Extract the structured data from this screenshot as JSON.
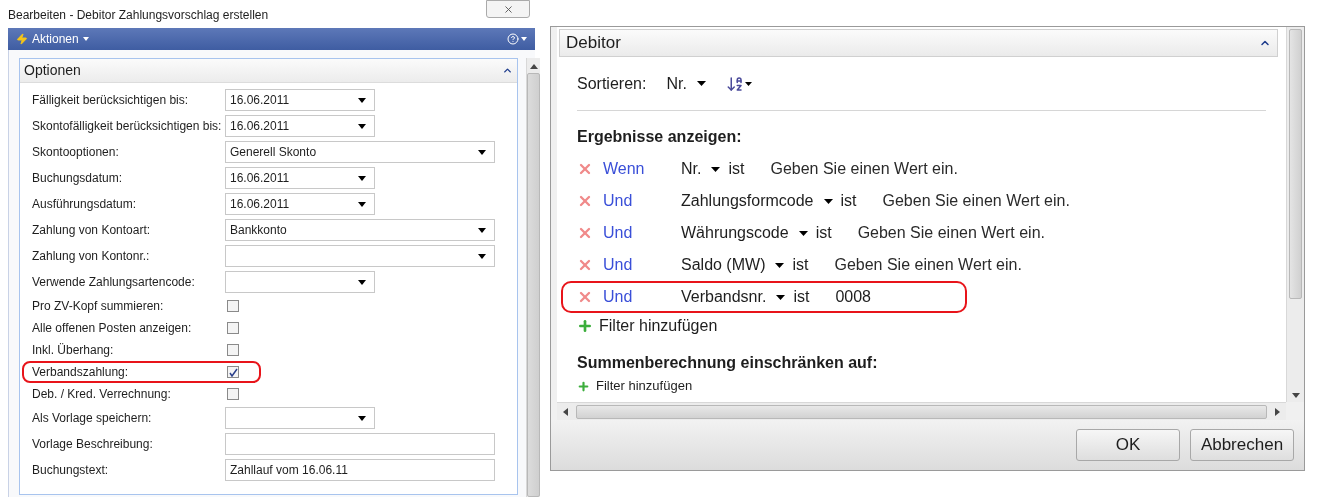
{
  "left": {
    "title": "Bearbeiten - Debitor Zahlungsvorschlag erstellen",
    "actions_menu": "Aktionen",
    "section": {
      "title": "Optionen",
      "expanded": true
    },
    "fields": [
      {
        "label": "Fälligkeit berücksichtigen bis:",
        "kind": "short-dropdown",
        "value": "16.06.2011",
        "highlighted": false
      },
      {
        "label": "Skontofälligkeit berücksichtigen bis:",
        "kind": "short-dropdown",
        "value": "16.06.2011",
        "highlighted": false
      },
      {
        "label": "Skontooptionen:",
        "kind": "wide-dropdown",
        "value": "Generell Skonto",
        "highlighted": false
      },
      {
        "label": "Buchungsdatum:",
        "kind": "short-dropdown",
        "value": "16.06.2011",
        "highlighted": false
      },
      {
        "label": "Ausführungsdatum:",
        "kind": "short-dropdown",
        "value": "16.06.2011",
        "highlighted": false
      },
      {
        "label": "Zahlung von Kontoart:",
        "kind": "wide-dropdown",
        "value": "Bankkonto",
        "highlighted": false
      },
      {
        "label": "Zahlung von Kontonr.:",
        "kind": "wide-dropdown",
        "highlighted": false
      },
      {
        "label": "Verwende Zahlungsartencode:",
        "kind": "short-dropdown",
        "highlighted": false
      },
      {
        "label": "Pro ZV-Kopf summieren:",
        "kind": "checkbox",
        "checked": false,
        "highlighted": false
      },
      {
        "label": "Alle offenen Posten anzeigen:",
        "kind": "checkbox",
        "checked": false,
        "highlighted": false
      },
      {
        "label": "Inkl. Überhang:",
        "kind": "checkbox",
        "checked": false,
        "highlighted": false
      },
      {
        "label": "Verbandszahlung:",
        "kind": "checkbox",
        "checked": true,
        "highlighted": true
      },
      {
        "label": "Deb. / Kred. Verrechnung:",
        "kind": "checkbox",
        "checked": false,
        "highlighted": false
      },
      {
        "label": "Als Vorlage speichern:",
        "kind": "short-dropdown",
        "highlighted": false
      },
      {
        "label": "Vorlage Beschreibung:",
        "kind": "text",
        "highlighted": false
      },
      {
        "label": "Buchungstext:",
        "kind": "text",
        "value": "Zahllauf vom 16.06.11",
        "highlighted": false
      }
    ]
  },
  "right": {
    "section": {
      "title": "Debitor",
      "expanded": true
    },
    "sort": {
      "label": "Sortieren:",
      "field": "Nr."
    },
    "results_heading": "Ergebnisse anzeigen:",
    "filters": [
      {
        "connector": "Wenn",
        "field": "Nr.",
        "operator": "ist",
        "placeholder": "Geben Sie einen Wert ein.",
        "highlighted": false
      },
      {
        "connector": "Und",
        "field": "Zahlungsformcode",
        "operator": "ist",
        "placeholder": "Geben Sie einen Wert ein.",
        "highlighted": false
      },
      {
        "connector": "Und",
        "field": "Währungscode",
        "operator": "ist",
        "placeholder": "Geben Sie einen Wert ein.",
        "highlighted": false
      },
      {
        "connector": "Und",
        "field": "Saldo (MW)",
        "operator": "ist",
        "placeholder": "Geben Sie einen Wert ein.",
        "highlighted": false
      },
      {
        "connector": "Und",
        "field": "Verbandsnr.",
        "operator": "ist",
        "value": "0008",
        "highlighted": true
      }
    ],
    "add_filter": "Filter hinzufügen",
    "totals_heading": "Summenberechnung einschränken auf:",
    "add_totals_filter": "Filter hinzufügen",
    "buttons": [
      "OK",
      "Abbrechen"
    ]
  }
}
